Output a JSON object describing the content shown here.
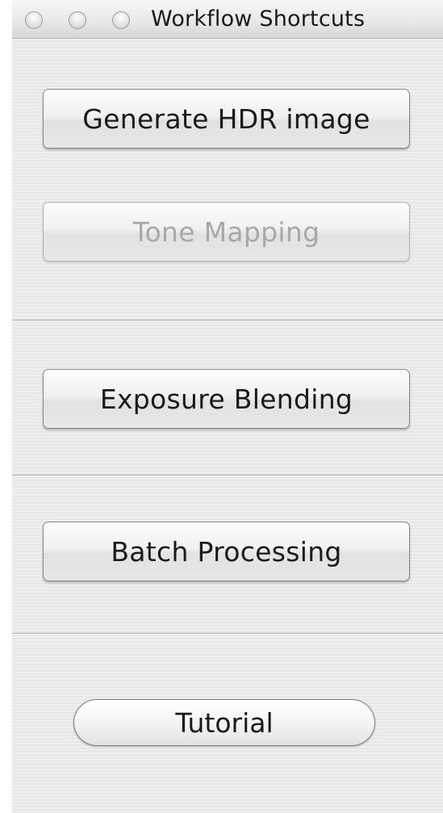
{
  "window": {
    "title": "Workflow Shortcuts"
  },
  "buttons": {
    "generate_hdr": {
      "label": "Generate HDR image",
      "enabled": true
    },
    "tone_mapping": {
      "label": "Tone Mapping",
      "enabled": false
    },
    "exposure_blending": {
      "label": "Exposure Blending",
      "enabled": true
    },
    "batch_processing": {
      "label": "Batch Processing",
      "enabled": true
    },
    "tutorial": {
      "label": "Tutorial",
      "enabled": true
    }
  },
  "colors": {
    "window_background": "#eeeeee",
    "disabled_text": "#a8a8a8",
    "text": "#1a1a1a"
  }
}
